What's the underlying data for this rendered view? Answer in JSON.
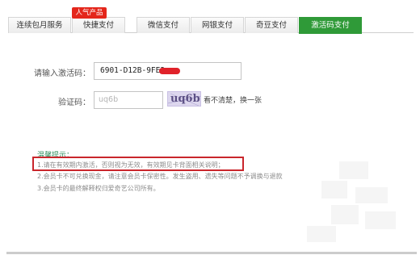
{
  "tabs": [
    {
      "label": "连续包月服务",
      "active": false
    },
    {
      "label": "快捷支付",
      "active": false
    },
    {
      "label": "微信支付",
      "active": false
    },
    {
      "label": "网银支付",
      "active": false
    },
    {
      "label": "奇豆支付",
      "active": false
    },
    {
      "label": "激活码支付",
      "active": true
    }
  ],
  "hot_badge": "人气产品",
  "form": {
    "code_label": "请输入激活码：",
    "code_value": "6901-D12B-9FE3",
    "captcha_label": "验证码：",
    "captcha_placeholder": "uq6b",
    "captcha_text": "uq6b",
    "refresh_text": "看不清楚，换一张"
  },
  "tips": {
    "title": "温馨提示：",
    "items": [
      "1.请在有效期内激活，否则视为无效，有效期见卡背面相关说明；",
      "2.会员卡不可兑换现金，请注意会员卡保密性。发生盗用、遗失等问题不予调换与退款",
      "3.会员卡的最终解释权归爱奇艺公司所有。"
    ]
  },
  "colors": {
    "active_tab": "#2f9a38",
    "badge": "#e4261b",
    "highlight": "#c9262c",
    "tips_title": "#2c8c5a"
  }
}
